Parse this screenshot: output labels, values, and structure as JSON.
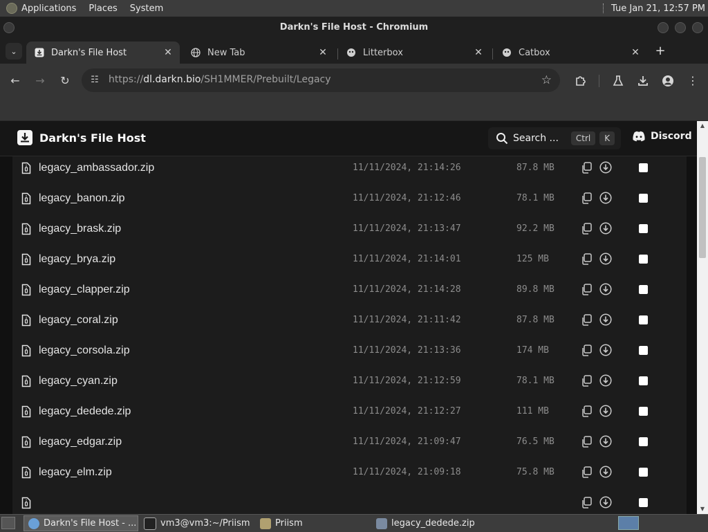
{
  "system_bar": {
    "menus": [
      "Applications",
      "Places",
      "System"
    ],
    "clock": "Tue Jan 21, 12:57 PM"
  },
  "window": {
    "title": "Darkn's File Host - Chromium"
  },
  "tabs": [
    {
      "label": "Darkn's File Host",
      "icon": "download-box-icon",
      "active": true
    },
    {
      "label": "New Tab",
      "icon": "globe-icon",
      "active": false
    },
    {
      "label": "Litterbox",
      "icon": "litterbox-icon",
      "active": false
    },
    {
      "label": "Catbox",
      "icon": "catbox-icon",
      "active": false
    }
  ],
  "address": {
    "scheme": "https://",
    "host": "dl.darkn.bio",
    "path": "/SH1MMER/Prebuilt/Legacy"
  },
  "site": {
    "brand": "Darkn's File Host",
    "search_label": "Search ...",
    "search_kbd": [
      "Ctrl",
      "K"
    ],
    "discord_label": "Discord"
  },
  "rows": [
    {
      "name": "legacy_ambassador.zip",
      "date": "11/11/2024, 21:14:26",
      "size": "87.8 MB"
    },
    {
      "name": "legacy_banon.zip",
      "date": "11/11/2024, 21:12:46",
      "size": "78.1 MB"
    },
    {
      "name": "legacy_brask.zip",
      "date": "11/11/2024, 21:13:47",
      "size": "92.2 MB"
    },
    {
      "name": "legacy_brya.zip",
      "date": "11/11/2024, 21:14:01",
      "size": "125 MB"
    },
    {
      "name": "legacy_clapper.zip",
      "date": "11/11/2024, 21:14:28",
      "size": "89.8 MB"
    },
    {
      "name": "legacy_coral.zip",
      "date": "11/11/2024, 21:11:42",
      "size": "87.8 MB"
    },
    {
      "name": "legacy_corsola.zip",
      "date": "11/11/2024, 21:13:36",
      "size": "174 MB"
    },
    {
      "name": "legacy_cyan.zip",
      "date": "11/11/2024, 21:12:59",
      "size": "78.1 MB"
    },
    {
      "name": "legacy_dedede.zip",
      "date": "11/11/2024, 21:12:27",
      "size": "111 MB"
    },
    {
      "name": "legacy_edgar.zip",
      "date": "11/11/2024, 21:09:47",
      "size": "76.5 MB"
    },
    {
      "name": "legacy_elm.zip",
      "date": "11/11/2024, 21:09:18",
      "size": "75.8 MB"
    }
  ],
  "taskbar": {
    "items": [
      {
        "label": "Darkn's File Host - ...",
        "icon": "chromium-icon",
        "active": true
      },
      {
        "label": "vm3@vm3:~/Priism",
        "icon": "terminal-icon",
        "active": false
      },
      {
        "label": "Priism",
        "icon": "folder-icon",
        "active": false
      },
      {
        "label": "legacy_dedede.zip",
        "icon": "archive-icon",
        "active": false
      }
    ]
  },
  "colors": {
    "page_bg": "#111111",
    "list_bg": "#1c1c1c",
    "text_primary": "#e4e4e4",
    "text_muted": "#8c8c8c",
    "chrome_toolbar": "#353535"
  }
}
